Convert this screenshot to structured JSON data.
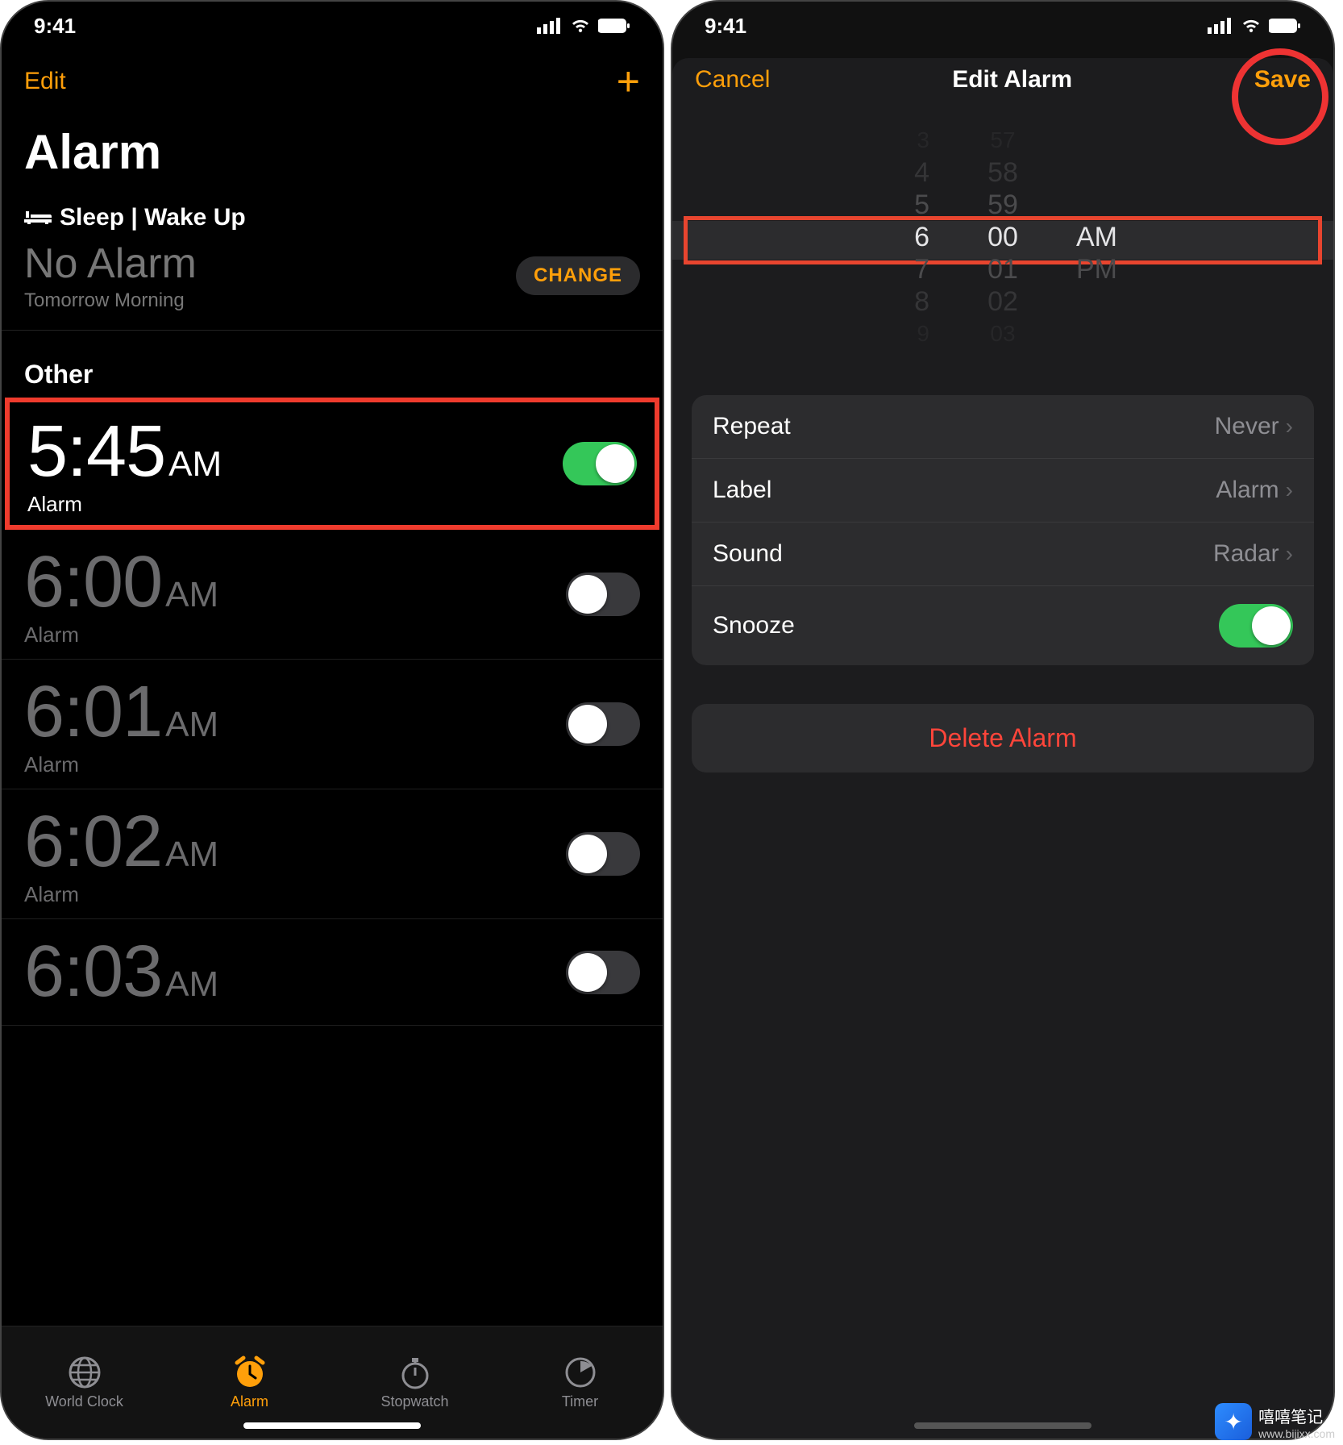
{
  "status_time": "9:41",
  "left": {
    "edit": "Edit",
    "title": "Alarm",
    "sleep_header": "Sleep | Wake Up",
    "no_alarm": "No Alarm",
    "tomorrow": "Tomorrow Morning",
    "change": "CHANGE",
    "other": "Other",
    "alarms": [
      {
        "time": "5:45",
        "ampm": "AM",
        "label": "Alarm",
        "on": true,
        "highlight": true
      },
      {
        "time": "6:00",
        "ampm": "AM",
        "label": "Alarm",
        "on": false,
        "highlight": false
      },
      {
        "time": "6:01",
        "ampm": "AM",
        "label": "Alarm",
        "on": false,
        "highlight": false
      },
      {
        "time": "6:02",
        "ampm": "AM",
        "label": "Alarm",
        "on": false,
        "highlight": false
      },
      {
        "time": "6:03",
        "ampm": "AM",
        "label": "",
        "on": false,
        "highlight": false
      }
    ],
    "tabs": {
      "world": "World Clock",
      "alarm": "Alarm",
      "stopwatch": "Stopwatch",
      "timer": "Timer"
    }
  },
  "right": {
    "cancel": "Cancel",
    "title": "Edit Alarm",
    "save": "Save",
    "picker": {
      "hours": [
        "3",
        "4",
        "5",
        "6",
        "7",
        "8",
        "9"
      ],
      "mins": [
        "57",
        "58",
        "59",
        "00",
        "01",
        "02",
        "03"
      ],
      "ampm_sel": "AM",
      "ampm_other": "PM",
      "selected_index": 3
    },
    "rows": {
      "repeat": {
        "label": "Repeat",
        "value": "Never"
      },
      "label": {
        "label": "Label",
        "value": "Alarm"
      },
      "sound": {
        "label": "Sound",
        "value": "Radar"
      },
      "snooze": {
        "label": "Snooze",
        "on": true
      }
    },
    "delete": "Delete Alarm"
  },
  "watermark": {
    "line1": "嘻嘻笔记",
    "line2": "www.bijixx.com"
  }
}
